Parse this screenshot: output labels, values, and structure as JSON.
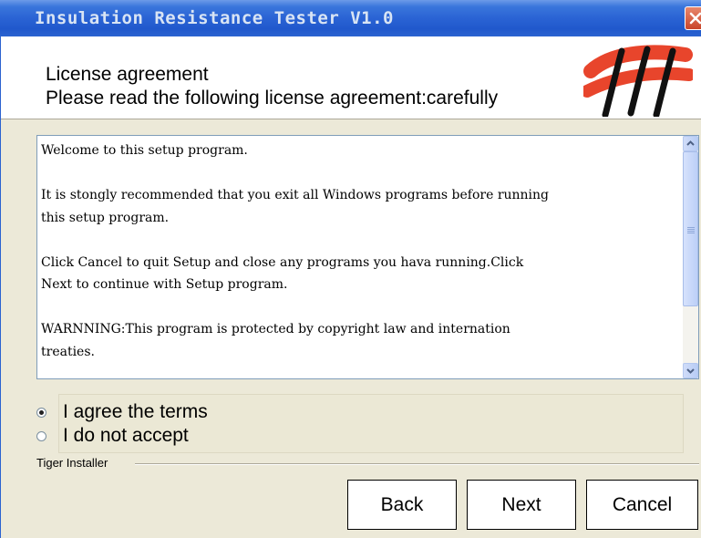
{
  "window": {
    "title": "Insulation Resistance Tester V1.0",
    "close_icon": "close-icon"
  },
  "header": {
    "title": "License agreement",
    "subtitle": "Please read the following license agreement:carefully",
    "logo_icon": "scribble-logo-icon"
  },
  "license": {
    "text": "Welcome to this setup program.\n\nIt is stongly recommended that you exit all Windows programs before running\nthis setup program.\n\nClick Cancel to quit Setup and close any programs you hava running.Click\nNext to continue with Setup program.\n\nWARNNING:This program is protected by copyright law and internation\ntreaties."
  },
  "options": {
    "agree": {
      "label": "I agree the terms",
      "selected": true
    },
    "decline": {
      "label": "I do not accept",
      "selected": false
    }
  },
  "footer": {
    "group_label": "Tiger Installer",
    "back_label": "Back",
    "next_label": "Next",
    "cancel_label": "Cancel"
  },
  "colors": {
    "titlebar": "#2a63d4",
    "window_bg": "#ece9d8",
    "logo_red": "#e8452c"
  }
}
